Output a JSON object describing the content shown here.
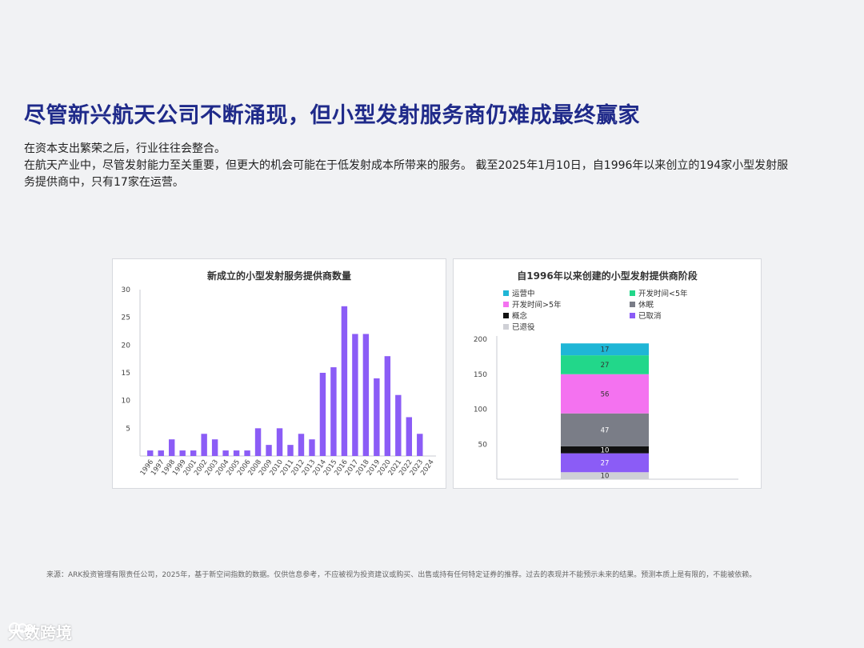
{
  "header": {
    "title": "尽管新兴航天公司不断涌现，但小型发射服务商仍难成最终赢家",
    "line1": "在资本支出繁荣之后，行业往往会整合。",
    "line2": "在航天产业中，尽管发射能力至关重要，但更大的机会可能在于低发射成本所带来的服务。 截至2025年1月10日，自1996年以来创立的194家小型发射服务提供商中，只有17家在运营。"
  },
  "footnote": "来源：ARK投资管理有限责任公司，2025年，基于新空间指数的数据。仅供信息参考，不应被视为投资建议或购买、出售或持有任何特定证券的推荐。过去的表现并不能预示未来的结果。预测本质上是有限的，不能被依赖。",
  "watermark": {
    "text": "大数跨境"
  },
  "colors": {
    "bar": "#8b5cf6",
    "title": "#1f2a8a"
  },
  "chart_data": [
    {
      "type": "bar",
      "title": "新成立的小型发射服务提供商数量",
      "xlabel": "",
      "ylabel": "",
      "categories": [
        "1996",
        "1997",
        "1998",
        "1999",
        "2001",
        "2002",
        "2003",
        "2004",
        "2005",
        "2006",
        "2008",
        "2009",
        "2010",
        "2011",
        "2012",
        "2013",
        "2014",
        "2015",
        "2016",
        "2017",
        "2018",
        "2019",
        "2020",
        "2021",
        "2022",
        "2023",
        "2024"
      ],
      "values": [
        1,
        1,
        3,
        1,
        1,
        4,
        3,
        1,
        1,
        1,
        5,
        2,
        5,
        2,
        4,
        3,
        15,
        16,
        27,
        22,
        22,
        14,
        18,
        11,
        7,
        4,
        0
      ],
      "ylim": [
        0,
        30
      ],
      "yticks": [
        5,
        10,
        15,
        20,
        25,
        30
      ],
      "color": "#8b5cf6"
    },
    {
      "type": "bar",
      "stacked": true,
      "title": "自1996年以来创建的小型发射提供商阶段",
      "ylim": [
        0,
        200
      ],
      "yticks": [
        50,
        100,
        150,
        200
      ],
      "legend_position": "top",
      "series": [
        {
          "name": "已退役",
          "value": 10,
          "color": "#cfd0d6",
          "label": "10"
        },
        {
          "name": "已取消",
          "value": 27,
          "color": "#8b5cf6",
          "label": "27"
        },
        {
          "name": "概念",
          "value": 10,
          "color": "#111111",
          "label": "10"
        },
        {
          "name": "休眠",
          "value": 47,
          "color": "#7a7d87",
          "label": "47"
        },
        {
          "name": "开发时间>5年",
          "value": 56,
          "color": "#f472f0",
          "label": "56"
        },
        {
          "name": "开发时间<5年",
          "value": 27,
          "color": "#22d78a",
          "label": "27"
        },
        {
          "name": "运营中",
          "value": 17,
          "color": "#1fb6d6",
          "label": "17"
        }
      ],
      "legend_order": [
        "运营中",
        "开发时间<5年",
        "开发时间>5年",
        "休眠",
        "概念",
        "已取消",
        "已退役"
      ]
    }
  ]
}
